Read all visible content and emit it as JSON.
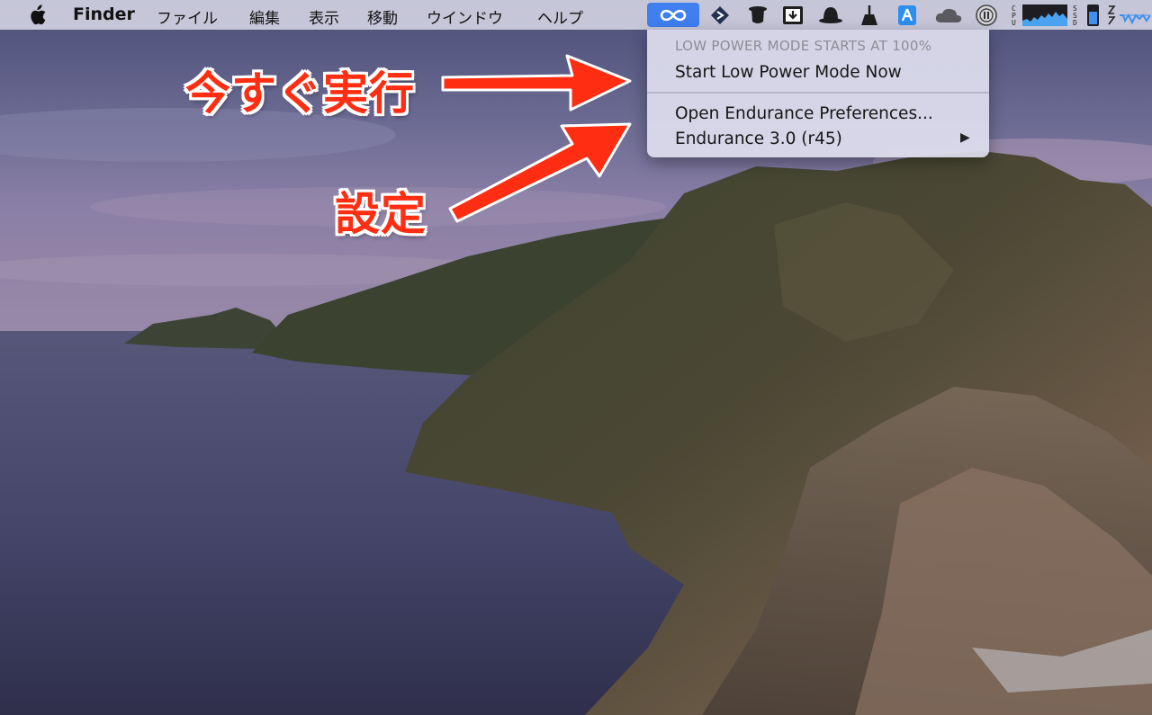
{
  "menubar": {
    "app_name": "Finder",
    "menus": [
      "ファイル",
      "編集",
      "表示",
      "移動",
      "ウインドウ",
      "ヘルプ"
    ],
    "status_icons": [
      "endurance-infinity-icon",
      "direction-icon",
      "magic-hat-icon",
      "download-box-icon",
      "bowler-hat-icon",
      "broom-icon",
      "app-store-icon",
      "cloud-icon",
      "pause-icon",
      "cpu-monitor-icon",
      "ssd-monitor-icon",
      "network-monitor-icon"
    ],
    "cpu_label": "CPU",
    "ssd_label": "SSD",
    "accent_color": "#3f7ff0"
  },
  "dropdown": {
    "header": "LOW POWER MODE STARTS AT 100%",
    "start_now": "Start Low Power Mode Now",
    "preferences": "Open Endurance Preferences...",
    "version": "Endurance 3.0 (r45)",
    "submenu_arrow": "▶"
  },
  "annotations": {
    "run_now": "今すぐ実行",
    "settings": "設定",
    "color": "#ff2d12"
  }
}
